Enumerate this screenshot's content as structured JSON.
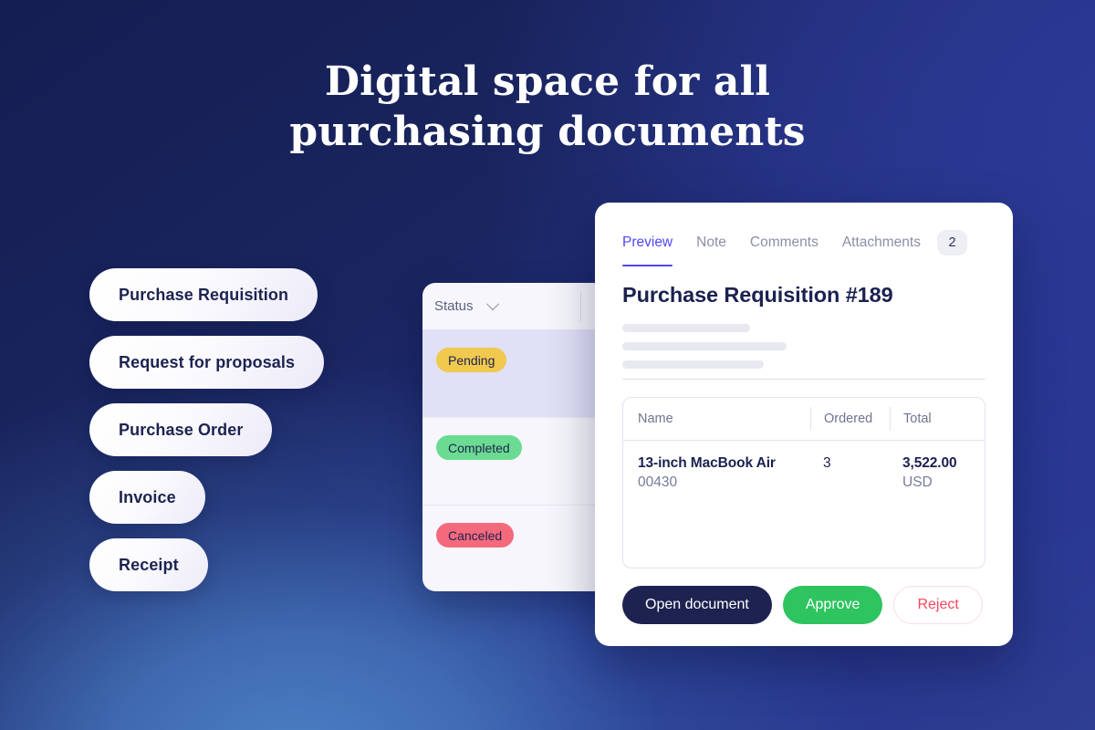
{
  "headline": {
    "line1": "Digital space for all",
    "line2": "purchasing documents"
  },
  "doc_types": [
    {
      "label": "Purchase Requisition"
    },
    {
      "label": "Request for proposals"
    },
    {
      "label": "Purchase Order"
    },
    {
      "label": "Invoice"
    },
    {
      "label": "Receipt"
    }
  ],
  "status_panel": {
    "column_header": "Status",
    "chevron_icon": "chevron-down-icon",
    "rows": [
      {
        "status": "Pending",
        "color": "#f0c94e",
        "highlighted": true
      },
      {
        "status": "Completed",
        "color": "#6bdb91",
        "highlighted": false
      },
      {
        "status": "Canceled",
        "color": "#f4697c",
        "highlighted": false
      }
    ]
  },
  "detail_card": {
    "tabs": [
      {
        "label": "Preview",
        "active": true
      },
      {
        "label": "Note",
        "active": false
      },
      {
        "label": "Comments",
        "active": false
      },
      {
        "label": "Attachments",
        "active": false
      }
    ],
    "attachments_count": "2",
    "title": "Purchase Requisition #189",
    "skeleton_widths": [
      "140px",
      "180px",
      "155px"
    ],
    "table": {
      "columns": [
        "Name",
        "Ordered",
        "Total"
      ],
      "rows": [
        {
          "name": "13-inch MacBook Air",
          "code": "00430",
          "ordered": "3",
          "amount": "3,522.00",
          "currency": "USD"
        }
      ]
    },
    "actions": {
      "open": "Open document",
      "approve": "Approve",
      "reject": "Reject"
    }
  },
  "colors": {
    "accent": "#4f46f5",
    "dark": "#1e2250",
    "approve": "#2ec45f",
    "reject": "#f5465d",
    "pending": "#f0c94e",
    "completed": "#6bdb91",
    "canceled": "#f4697c"
  }
}
